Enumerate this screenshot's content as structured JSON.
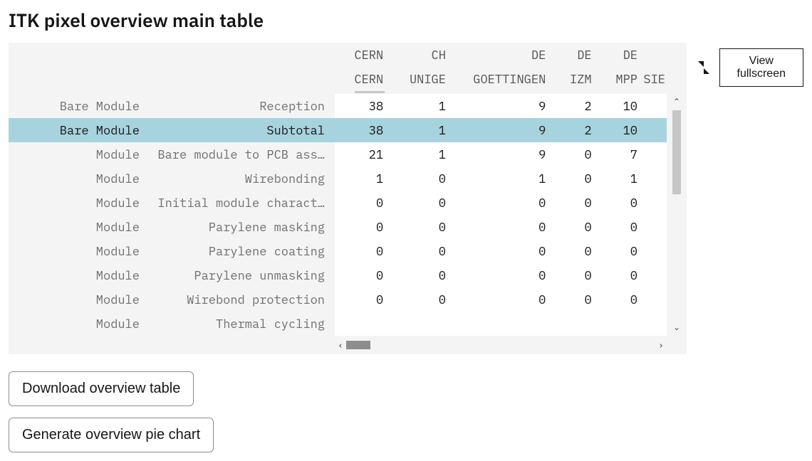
{
  "title": "ITK pixel overview main table",
  "header": {
    "row1": [
      "CERN",
      "CH",
      "DE",
      "DE",
      "DE",
      ""
    ],
    "row2": [
      "CERN",
      "UNIGE",
      "GOETTINGEN",
      "IZM",
      "MPP",
      "SIE"
    ]
  },
  "rows": [
    {
      "cat": "Bare Module",
      "step": "Reception",
      "vals": [
        "38",
        "1",
        "9",
        "2",
        "10",
        ""
      ],
      "subtotal": false
    },
    {
      "cat": "Bare Module",
      "step": "Subtotal",
      "vals": [
        "38",
        "1",
        "9",
        "2",
        "10",
        ""
      ],
      "subtotal": true
    },
    {
      "cat": "Module",
      "step": "Bare module to PCB ass…",
      "vals": [
        "21",
        "1",
        "9",
        "0",
        "7",
        ""
      ],
      "subtotal": false
    },
    {
      "cat": "Module",
      "step": "Wirebonding",
      "vals": [
        "1",
        "0",
        "1",
        "0",
        "1",
        ""
      ],
      "subtotal": false
    },
    {
      "cat": "Module",
      "step": "Initial module charact…",
      "vals": [
        "0",
        "0",
        "0",
        "0",
        "0",
        ""
      ],
      "subtotal": false
    },
    {
      "cat": "Module",
      "step": "Parylene masking",
      "vals": [
        "0",
        "0",
        "0",
        "0",
        "0",
        ""
      ],
      "subtotal": false
    },
    {
      "cat": "Module",
      "step": "Parylene coating",
      "vals": [
        "0",
        "0",
        "0",
        "0",
        "0",
        ""
      ],
      "subtotal": false
    },
    {
      "cat": "Module",
      "step": "Parylene unmasking",
      "vals": [
        "0",
        "0",
        "0",
        "0",
        "0",
        ""
      ],
      "subtotal": false
    },
    {
      "cat": "Module",
      "step": "Wirebond protection",
      "vals": [
        "0",
        "0",
        "0",
        "0",
        "0",
        ""
      ],
      "subtotal": false
    },
    {
      "cat": "Module",
      "step": "Thermal cycling",
      "vals": [
        "",
        "",
        "",
        "",
        "",
        ""
      ],
      "subtotal": false
    }
  ],
  "side": {
    "view_fullscreen": "View fullscreen"
  },
  "buttons": {
    "download": "Download overview table",
    "piechart": "Generate overview pie chart"
  },
  "colors": {
    "subtotal_bg": "#a7d3de",
    "panel_bg": "#f4f4f4"
  }
}
